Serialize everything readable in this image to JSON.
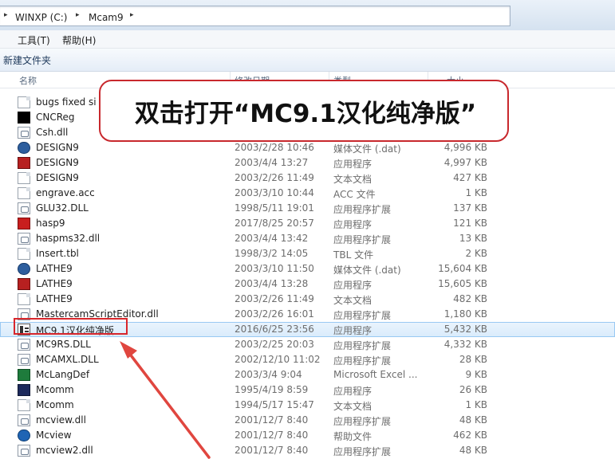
{
  "address_bar": {
    "crumbs": [
      "WINXP (C:)",
      "Mcam9"
    ],
    "separators": [
      "▸",
      "▸",
      "▸"
    ]
  },
  "menu_bar": {
    "items": [
      "工具(T)",
      "帮助(H)"
    ]
  },
  "toolbar": {
    "new_folder_label": "新建文件夹"
  },
  "columns": {
    "name": "名称",
    "date": "修改日期",
    "type": "类型",
    "size": "大小"
  },
  "callout": {
    "text": "双击打开“MC9.1汉化纯净版”"
  },
  "files": [
    {
      "name": "bugs fixed si",
      "date": "",
      "type": "",
      "size": "",
      "icon": "document-icon"
    },
    {
      "name": "CNCReg",
      "date": "",
      "type": "",
      "size": "",
      "icon": "cncreg-icon"
    },
    {
      "name": "Csh.dll",
      "date": "",
      "type": "",
      "size": "",
      "icon": "dll-icon"
    },
    {
      "name": "DESIGN9",
      "date": "2003/2/28 10:46",
      "type": "媒体文件 (.dat)",
      "size": "4,996 KB",
      "icon": "media-icon"
    },
    {
      "name": "DESIGN9",
      "date": "2003/4/4 13:27",
      "type": "应用程序",
      "size": "4,997 KB",
      "icon": "mastercam-app-icon"
    },
    {
      "name": "DESIGN9",
      "date": "2003/2/26 11:49",
      "type": "文本文档",
      "size": "427 KB",
      "icon": "document-icon"
    },
    {
      "name": "engrave.acc",
      "date": "2003/3/10 10:44",
      "type": "ACC 文件",
      "size": "1 KB",
      "icon": "document-icon"
    },
    {
      "name": "GLU32.DLL",
      "date": "1998/5/11 19:01",
      "type": "应用程序扩展",
      "size": "137 KB",
      "icon": "dll-icon"
    },
    {
      "name": "hasp9",
      "date": "2017/8/25 20:57",
      "type": "应用程序",
      "size": "121 KB",
      "icon": "hasp-app-icon"
    },
    {
      "name": "haspms32.dll",
      "date": "2003/4/4 13:42",
      "type": "应用程序扩展",
      "size": "13 KB",
      "icon": "dll-icon"
    },
    {
      "name": "Insert.tbl",
      "date": "1998/3/2 14:05",
      "type": "TBL 文件",
      "size": "2 KB",
      "icon": "document-icon"
    },
    {
      "name": "LATHE9",
      "date": "2003/3/10 11:50",
      "type": "媒体文件 (.dat)",
      "size": "15,604 KB",
      "icon": "media-icon"
    },
    {
      "name": "LATHE9",
      "date": "2003/4/4 13:28",
      "type": "应用程序",
      "size": "15,605 KB",
      "icon": "mastercam-app-icon"
    },
    {
      "name": "LATHE9",
      "date": "2003/2/26 11:49",
      "type": "文本文档",
      "size": "482 KB",
      "icon": "document-icon"
    },
    {
      "name": "MastercamScriptEditor.dll",
      "date": "2003/2/26 16:01",
      "type": "应用程序扩展",
      "size": "1,180 KB",
      "icon": "dll-icon"
    },
    {
      "name": "MC9.1汉化纯净版",
      "date": "2016/6/25 23:56",
      "type": "应用程序",
      "size": "5,432 KB",
      "icon": "mc9-app-icon",
      "selected": true
    },
    {
      "name": "MC9RS.DLL",
      "date": "2003/2/25 20:03",
      "type": "应用程序扩展",
      "size": "4,332 KB",
      "icon": "dll-icon"
    },
    {
      "name": "MCAMXL.DLL",
      "date": "2002/12/10 11:02",
      "type": "应用程序扩展",
      "size": "28 KB",
      "icon": "dll-icon"
    },
    {
      "name": "McLangDef",
      "date": "2003/3/4 9:04",
      "type": "Microsoft Excel ...",
      "size": "9 KB",
      "icon": "excel-icon"
    },
    {
      "name": "Mcomm",
      "date": "1995/4/19 8:59",
      "type": "应用程序",
      "size": "26 KB",
      "icon": "app-icon"
    },
    {
      "name": "Mcomm",
      "date": "1994/5/17 15:47",
      "type": "文本文档",
      "size": "1 KB",
      "icon": "document-icon"
    },
    {
      "name": "mcview.dll",
      "date": "2001/12/7 8:40",
      "type": "应用程序扩展",
      "size": "48 KB",
      "icon": "dll-icon"
    },
    {
      "name": "Mcview",
      "date": "2001/12/7 8:40",
      "type": "帮助文件",
      "size": "462 KB",
      "icon": "help-icon"
    },
    {
      "name": "mcview2.dll",
      "date": "2001/12/7 8:40",
      "type": "应用程序扩展",
      "size": "48 KB",
      "icon": "dll-icon"
    }
  ],
  "colors": {
    "callout_border": "#c8282d",
    "highlight_border": "#d8262b",
    "arrow": "#e0463f",
    "selection_fill": "#d9ebfb"
  }
}
